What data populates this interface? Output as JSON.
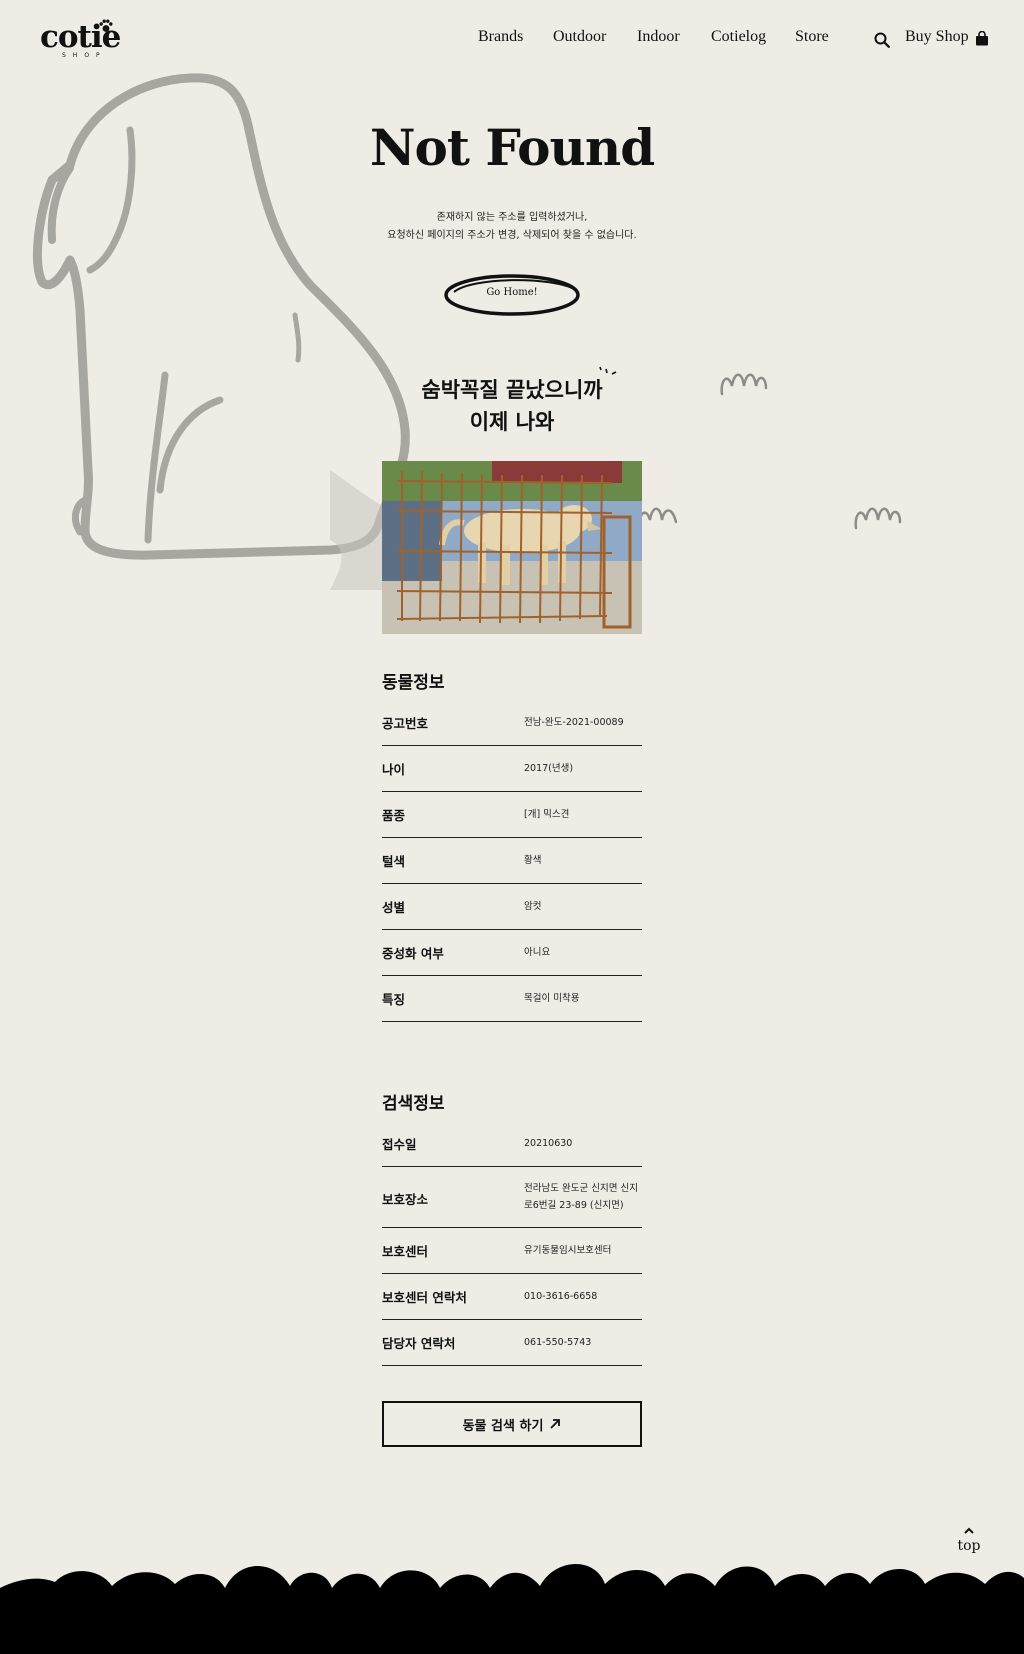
{
  "header": {
    "logo_text": "cotie",
    "logo_sub": "SHOP",
    "nav": [
      "Brands",
      "Outdoor",
      "Indoor",
      "Cotielog",
      "Store"
    ],
    "buy_shop": "Buy Shop"
  },
  "hero": {
    "title": "Not Found",
    "line1": "존재하지 않는 주소를 입력하셨거나,",
    "line2": "요청하신 페이지의 주소가 변경, 삭제되어 찾을 수 없습니다.",
    "go_home": "Go Home!"
  },
  "headline": {
    "line1": "숨박꼭질 끝났으니까",
    "line2": "이제 나와"
  },
  "animal_info": {
    "title": "동물정보",
    "rows": [
      {
        "label": "공고번호",
        "value": "전남-완도-2021-00089"
      },
      {
        "label": "나이",
        "value": "2017(년생)"
      },
      {
        "label": "품종",
        "value": "[개] 믹스견"
      },
      {
        "label": "털색",
        "value": "황색"
      },
      {
        "label": "성별",
        "value": "암컷"
      },
      {
        "label": "중성화 여부",
        "value": "아니요"
      },
      {
        "label": "특징",
        "value": "목걸이 미착용"
      }
    ]
  },
  "search_info": {
    "title": "검색정보",
    "rows": [
      {
        "label": "접수일",
        "value": "20210630"
      },
      {
        "label": "보호장소",
        "value": "전라남도 완도군 신지면 신지",
        "value2": "로6번길 23-89 (신지면)"
      },
      {
        "label": "보호센터",
        "value": "유기동물임시보호센터"
      },
      {
        "label": "보호센터 연락처",
        "value": "010-3616-6658"
      },
      {
        "label": "담당자 연락처",
        "value": "061-550-5743"
      }
    ]
  },
  "search_button": "동물 검색 하기",
  "top_label": "top",
  "icons": [
    "paw-icon",
    "search-icon",
    "bag-icon",
    "arrow-up-right-icon",
    "caret-up-icon"
  ],
  "colors": {
    "background": "#efece6",
    "ink": "#111111",
    "outline_gray": "#a8a6a1"
  }
}
